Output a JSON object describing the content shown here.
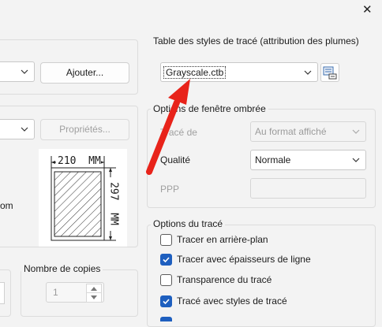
{
  "window": {
    "close_glyph": "✕"
  },
  "left": {
    "add_button": "Ajouter...",
    "properties_button": "Propriétés...",
    "paper_width_label": "210  MM",
    "paper_height_label": "297  MM",
    "partial_text": "om",
    "copies": {
      "title": "Nombre de copies",
      "value": "1"
    }
  },
  "plot_style_table": {
    "title": "Table des styles de tracé (attribution des plumes)",
    "selected": "Grayscale.ctb",
    "edit_icon": "plot-style-edit-icon"
  },
  "shaded_viewport": {
    "title": "Options de fenêtre ombrée",
    "trace_de_label": "Tracé de",
    "trace_de_value": "Au format affiché",
    "qualite_label": "Qualité",
    "qualite_value": "Normale",
    "ppp_label": "PPP",
    "ppp_value": ""
  },
  "plot_options": {
    "title": "Options du tracé",
    "items": [
      {
        "label": "Tracer en arrière-plan",
        "checked": false
      },
      {
        "label": "Tracer avec épaisseurs de ligne",
        "checked": true
      },
      {
        "label": "Transparence du tracé",
        "checked": false
      },
      {
        "label": "Tracé avec styles de tracé",
        "checked": true
      }
    ]
  },
  "colors": {
    "accent": "#1e5fbf",
    "arrow": "#e8231a"
  }
}
